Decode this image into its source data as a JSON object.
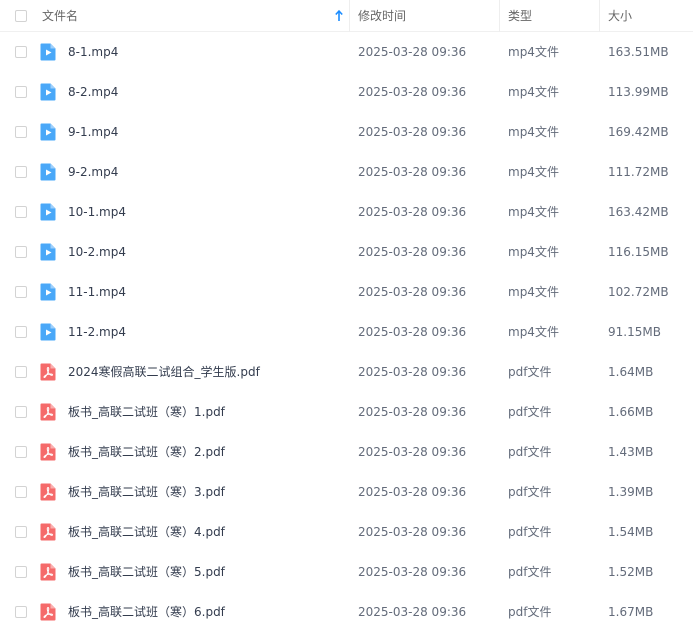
{
  "header": {
    "name": "文件名",
    "modified": "修改时间",
    "type": "类型",
    "size": "大小",
    "sort_icon": "arrow-up-icon"
  },
  "colors": {
    "video_icon": "#4aa8f8",
    "pdf_icon": "#f56a6a",
    "sort_arrow": "#1a8cff"
  },
  "files": [
    {
      "name": "8-1.mp4",
      "modified": "2025-03-28 09:36",
      "type": "mp4文件",
      "size": "163.51MB",
      "icon": "video-file-icon"
    },
    {
      "name": "8-2.mp4",
      "modified": "2025-03-28 09:36",
      "type": "mp4文件",
      "size": "113.99MB",
      "icon": "video-file-icon"
    },
    {
      "name": "9-1.mp4",
      "modified": "2025-03-28 09:36",
      "type": "mp4文件",
      "size": "169.42MB",
      "icon": "video-file-icon"
    },
    {
      "name": "9-2.mp4",
      "modified": "2025-03-28 09:36",
      "type": "mp4文件",
      "size": "111.72MB",
      "icon": "video-file-icon"
    },
    {
      "name": "10-1.mp4",
      "modified": "2025-03-28 09:36",
      "type": "mp4文件",
      "size": "163.42MB",
      "icon": "video-file-icon"
    },
    {
      "name": "10-2.mp4",
      "modified": "2025-03-28 09:36",
      "type": "mp4文件",
      "size": "116.15MB",
      "icon": "video-file-icon"
    },
    {
      "name": "11-1.mp4",
      "modified": "2025-03-28 09:36",
      "type": "mp4文件",
      "size": "102.72MB",
      "icon": "video-file-icon"
    },
    {
      "name": "11-2.mp4",
      "modified": "2025-03-28 09:36",
      "type": "mp4文件",
      "size": "91.15MB",
      "icon": "video-file-icon"
    },
    {
      "name": "2024寒假高联二试组合_学生版.pdf",
      "modified": "2025-03-28 09:36",
      "type": "pdf文件",
      "size": "1.64MB",
      "icon": "pdf-file-icon"
    },
    {
      "name": "板书_高联二试班（寒）1.pdf",
      "modified": "2025-03-28 09:36",
      "type": "pdf文件",
      "size": "1.66MB",
      "icon": "pdf-file-icon"
    },
    {
      "name": "板书_高联二试班（寒）2.pdf",
      "modified": "2025-03-28 09:36",
      "type": "pdf文件",
      "size": "1.43MB",
      "icon": "pdf-file-icon"
    },
    {
      "name": "板书_高联二试班（寒）3.pdf",
      "modified": "2025-03-28 09:36",
      "type": "pdf文件",
      "size": "1.39MB",
      "icon": "pdf-file-icon"
    },
    {
      "name": "板书_高联二试班（寒）4.pdf",
      "modified": "2025-03-28 09:36",
      "type": "pdf文件",
      "size": "1.54MB",
      "icon": "pdf-file-icon"
    },
    {
      "name": "板书_高联二试班（寒）5.pdf",
      "modified": "2025-03-28 09:36",
      "type": "pdf文件",
      "size": "1.52MB",
      "icon": "pdf-file-icon"
    },
    {
      "name": "板书_高联二试班（寒）6.pdf",
      "modified": "2025-03-28 09:36",
      "type": "pdf文件",
      "size": "1.67MB",
      "icon": "pdf-file-icon"
    }
  ]
}
